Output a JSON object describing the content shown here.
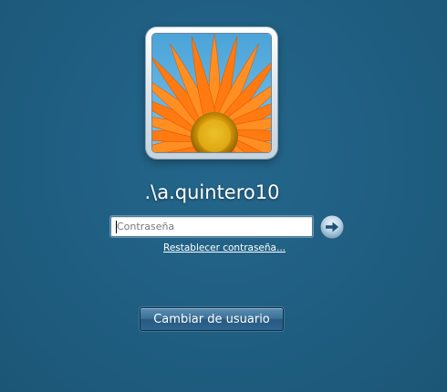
{
  "user": {
    "avatar_description": "orange-flower-icon",
    "username": ".\\a.quintero10"
  },
  "password": {
    "placeholder": "Contraseña",
    "value": ""
  },
  "actions": {
    "submit_icon": "arrow-right-icon",
    "reset_link": "Restablecer contraseña...",
    "switch_user": "Cambiar de usuario"
  },
  "colors": {
    "background": "#1f5d80",
    "flower_petal": "#ff7a10",
    "flower_center": "#e2b10c",
    "button": "#2e6690"
  }
}
